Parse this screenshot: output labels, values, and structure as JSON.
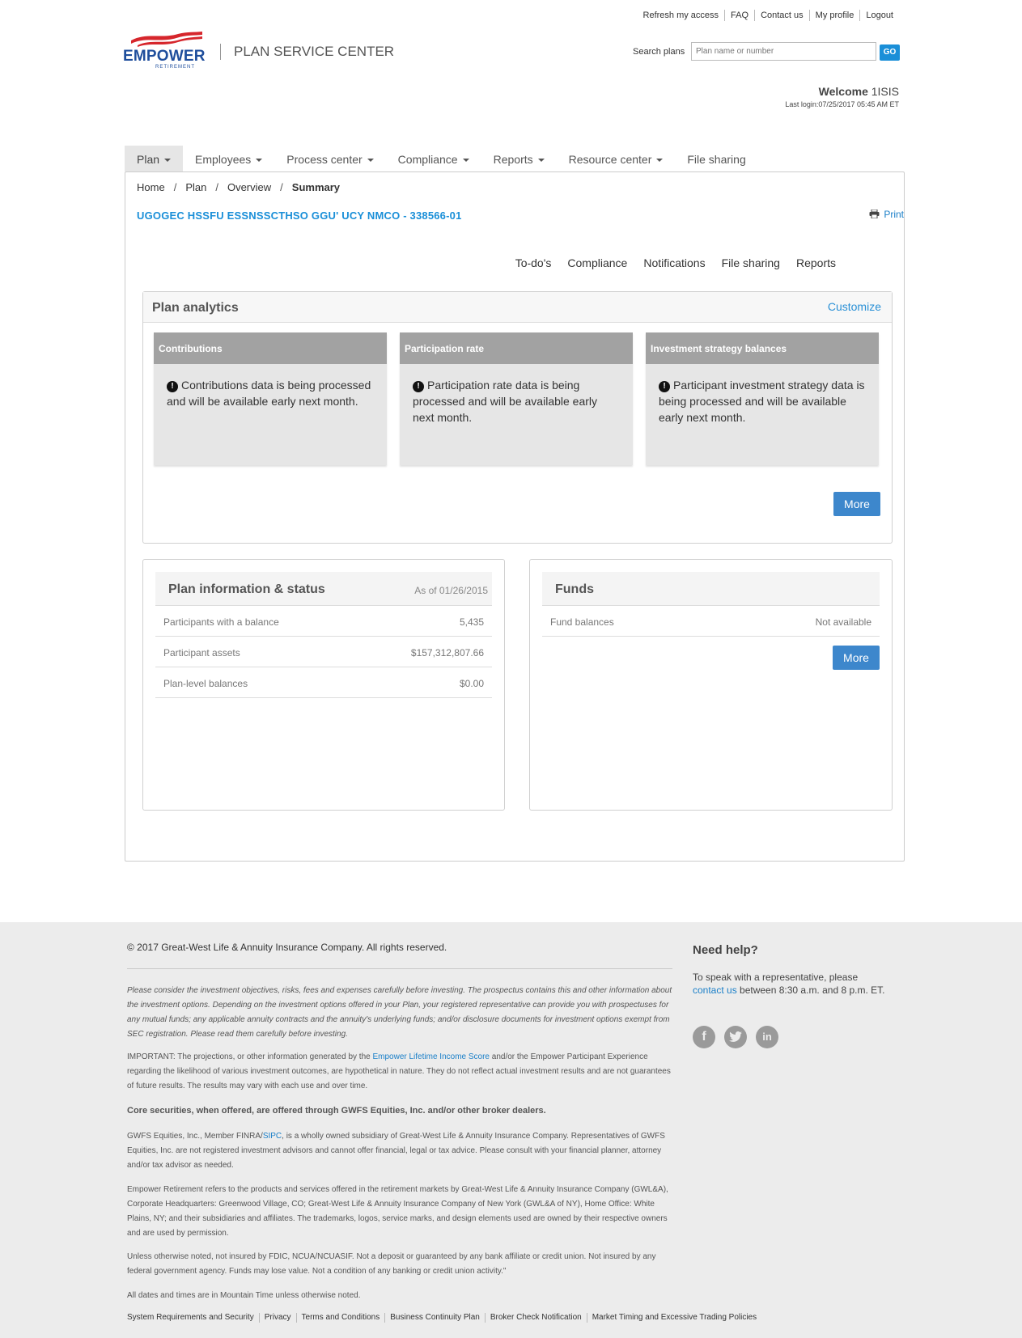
{
  "util_nav": [
    "Refresh my access",
    "FAQ",
    "Contact us",
    "My profile",
    "Logout"
  ],
  "brand": {
    "name": "EMPOWER",
    "sub": "RETIREMENT",
    "app_title": "PLAN SERVICE CENTER"
  },
  "search": {
    "label": "Search plans",
    "placeholder": "Plan name or number",
    "button": "GO"
  },
  "user": {
    "welcome": "Welcome",
    "name": "1ISIS",
    "last_login": "Last login:07/25/2017 05:45 AM ET"
  },
  "main_nav": [
    {
      "label": "Plan",
      "dropdown": true,
      "active": true
    },
    {
      "label": "Employees",
      "dropdown": true
    },
    {
      "label": "Process center",
      "dropdown": true
    },
    {
      "label": "Compliance",
      "dropdown": true
    },
    {
      "label": "Reports",
      "dropdown": true
    },
    {
      "label": "Resource center",
      "dropdown": true
    },
    {
      "label": "File sharing",
      "dropdown": false
    }
  ],
  "breadcrumb": [
    "Home",
    "Plan",
    "Overview",
    "Summary"
  ],
  "plan_title": "UGOGEC HSSFU ESSNSSCTHSO GGU' UCY NMCO - 338566-01",
  "print_label": "Print",
  "sub_nav": [
    "To-do's",
    "Compliance",
    "Notifications",
    "File sharing",
    "Reports"
  ],
  "analytics": {
    "title": "Plan analytics",
    "customize": "Customize",
    "more": "More",
    "tiles": [
      {
        "title": "Contributions",
        "message": "Contributions data is being processed and will be available early next month."
      },
      {
        "title": "Participation rate",
        "message": "Participation rate data is being processed and will be available early next month."
      },
      {
        "title": "Investment strategy balances",
        "message": "Participant investment strategy data is being processed and will be available early next month."
      }
    ]
  },
  "plan_info": {
    "title": "Plan information & status",
    "as_of": "As of 01/26/2015",
    "rows": [
      {
        "label": "Participants with a balance",
        "value": "5,435"
      },
      {
        "label": "Participant assets",
        "value": "$157,312,807.66"
      },
      {
        "label": "Plan-level balances",
        "value": "$0.00"
      }
    ]
  },
  "funds": {
    "title": "Funds",
    "rows": [
      {
        "label": "Fund balances",
        "value": "Not available"
      }
    ],
    "more": "More"
  },
  "footer": {
    "copyright": "© 2017 Great-West Life & Annuity Insurance Company. All rights reserved.",
    "disclaimer": "Please consider the investment objectives, risks, fees and expenses carefully before investing. The prospectus contains this and other information about the investment options. Depending on the investment options offered in your Plan, your registered representative can provide you with prospectuses for any mutual funds; any applicable annuity contracts and the annuity's underlying funds; and/or disclosure documents for investment options exempt from SEC registration. Please read them carefully before investing.",
    "important_pre": "IMPORTANT: The projections, or other information generated by the ",
    "important_link": "Empower Lifetime Income Score",
    "important_post": " and/or the Empower Participant Experience regarding the likelihood of various investment outcomes, are hypothetical in nature. They do not reflect actual investment results and are not guarantees of future results. The results may vary with each use and over time.",
    "core": "Core securities, when offered, are offered through GWFS Equities, Inc. and/or other broker dealers.",
    "gwfs_pre": "GWFS Equities, Inc., Member FINRA/",
    "gwfs_link": "SIPC",
    "gwfs_post": ", is a wholly owned subsidiary of Great-West Life & Annuity Insurance Company. Representatives of GWFS Equities, Inc. are not registered investment advisors and cannot offer financial, legal or tax advice. Please consult with your financial planner, attorney and/or tax advisor as needed.",
    "empower": "Empower Retirement refers to the products and services offered in the retirement markets by Great-West Life & Annuity Insurance Company (GWL&A), Corporate Headquarters: Greenwood Village, CO; Great-West Life & Annuity Insurance Company of New York (GWL&A of NY), Home Office: White Plains, NY; and their subsidiaries and affiliates. The trademarks, logos, service marks, and design elements used are owned by their respective owners and are used by permission.",
    "fdic": "Unless otherwise noted, not insured by FDIC, NCUA/NCUASIF. Not a deposit or guaranteed by any bank affiliate or credit union. Not insured by any federal government agency. Funds may lose value. Not a condition of any banking or credit union activity.\"",
    "dates": "All dates and times are in Mountain Time unless otherwise noted.",
    "links": [
      "System Requirements and Security",
      "Privacy",
      "Terms and Conditions",
      "Business Continuity Plan",
      "Broker Check Notification",
      "Market Timing and Excessive Trading Policies"
    ],
    "help_title": "Need help?",
    "help_pre": "To speak with a representative, please",
    "help_link": "contact us",
    "help_post": " between 8:30 a.m. and 8 p.m. ET.",
    "social": [
      "facebook-icon",
      "twitter-icon",
      "linkedin-icon"
    ]
  }
}
